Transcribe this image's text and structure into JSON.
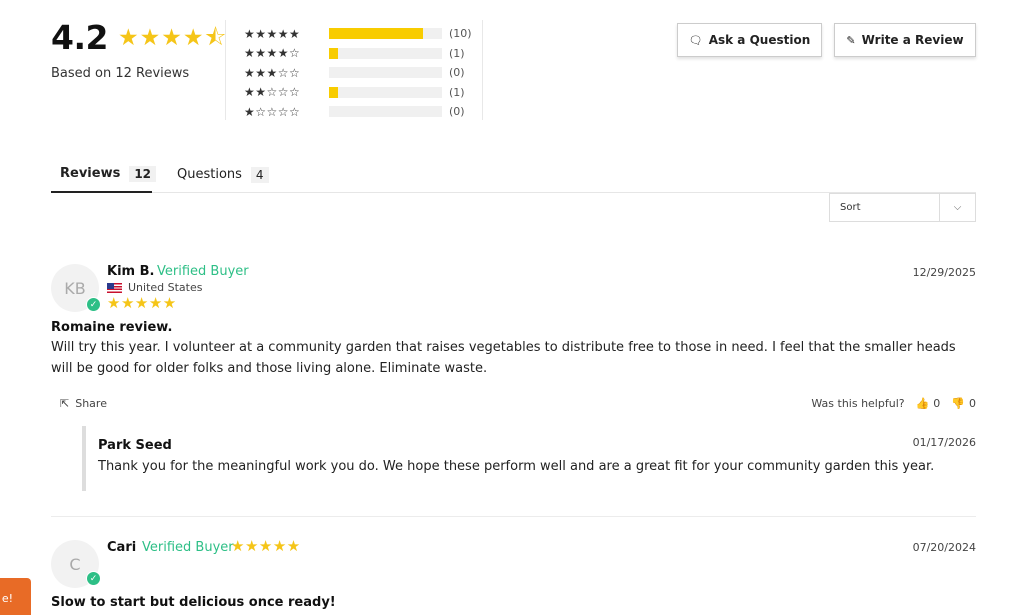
{
  "summary": {
    "average": "4.2",
    "average_stars": "★★★★⯪",
    "based_on": "Based on 12 Reviews"
  },
  "distribution": [
    {
      "stars": "★★★★★",
      "count": "(10)",
      "fill": 0.83
    },
    {
      "stars": "★★★★☆",
      "count": "(1)",
      "fill": 0.08
    },
    {
      "stars": "★★★☆☆",
      "count": "(0)",
      "fill": 0
    },
    {
      "stars": "★★☆☆☆",
      "count": "(1)",
      "fill": 0.08
    },
    {
      "stars": "★☆☆☆☆",
      "count": "(0)",
      "fill": 0
    }
  ],
  "buttons": {
    "ask": "Ask a Question",
    "write": "Write a Review"
  },
  "tabs": [
    {
      "label": "Reviews",
      "count": "12"
    },
    {
      "label": "Questions",
      "count": "4"
    }
  ],
  "sort": {
    "label": "Sort"
  },
  "reviews": [
    {
      "initials": "KB",
      "name": "Kim B.",
      "verified": "Verified Buyer",
      "country": "United States",
      "stars": "★★★★★",
      "date": "12/29/2025",
      "title": "Romaine review.",
      "body": "Will try this year. I volunteer at a community garden that raises vegetables to distribute free to those in need. I feel that the smaller heads will be good for older folks and those living alone. Eliminate waste.",
      "share": "Share",
      "helpful": "Was this helpful?",
      "up": "0",
      "down": "0",
      "reply": {
        "name": "Park Seed",
        "date": "01/17/2026",
        "body": "Thank you for the meaningful work you do. We hope these perform well and are a great fit for your community garden this year."
      }
    },
    {
      "initials": "C",
      "name": "Cari",
      "verified": "Verified Buyer",
      "stars": "★★★★★",
      "date": "07/20/2024",
      "title": "Slow to start but delicious once ready!"
    }
  ],
  "reward_tab": "e!"
}
